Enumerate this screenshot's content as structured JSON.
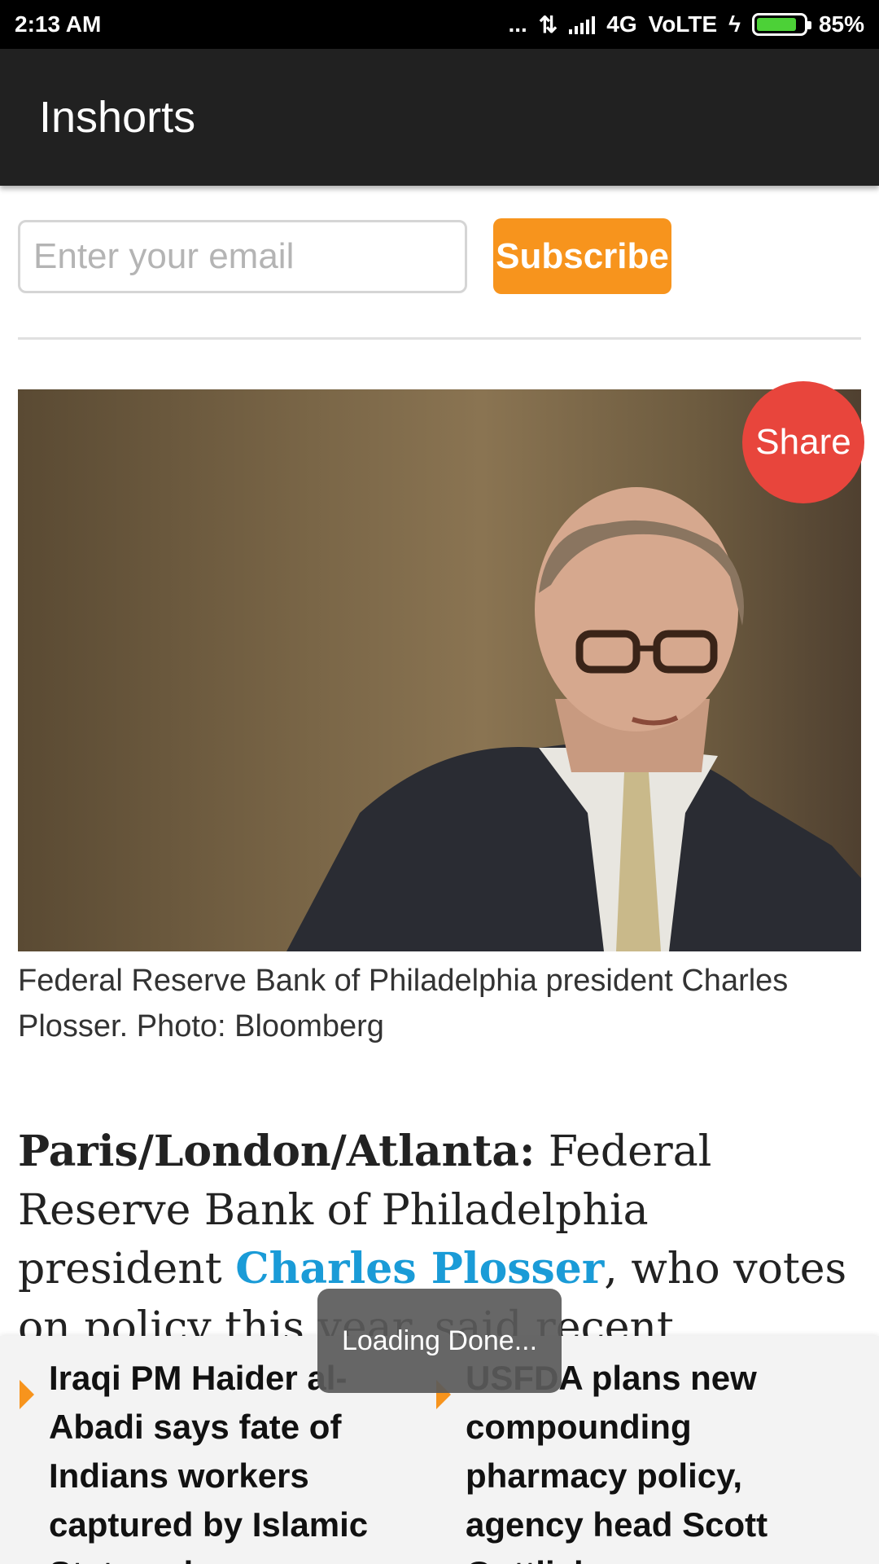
{
  "status_bar": {
    "time": "2:13 AM",
    "dots": "...",
    "network": "4G",
    "volte": "VoLTE",
    "battery_level": 0.85,
    "battery_text": "85%"
  },
  "app_bar": {
    "title": "Inshorts"
  },
  "subscribe": {
    "email_placeholder": "Enter your email",
    "button_label": "Subscribe"
  },
  "share": {
    "label": "Share"
  },
  "photo": {
    "caption": "Federal Reserve Bank of Philadelphia president Charles Plosser. Photo: Bloomberg"
  },
  "article": {
    "location": "Paris/London/Atlanta:",
    "text_before_link": " Federal Reserve Bank of Philadelphia president ",
    "link_text": "Charles Plosser",
    "text_after_link": ", who votes on policy this year, said recent encouraging economic data"
  },
  "related": [
    {
      "headline": "Iraqi PM Haider al-Abadi says fate of Indians workers captured by Islamic State unknown"
    },
    {
      "headline": "USFDA plans new compounding pharmacy policy, agency head Scott Gottlieb says"
    }
  ],
  "toast": {
    "text": "Loading Done..."
  },
  "colors": {
    "accent_orange": "#f7941d",
    "share_red": "#e8453c",
    "link_blue": "#1a9bd7",
    "app_bar_dark": "#212121"
  }
}
